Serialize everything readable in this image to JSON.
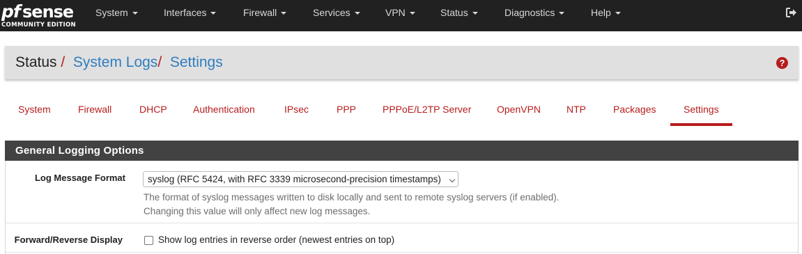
{
  "brand": {
    "logo_pf": "pf",
    "logo_sense": "sense",
    "logo_edition": "COMMUNITY EDITION"
  },
  "nav": {
    "items": [
      "System",
      "Interfaces",
      "Firewall",
      "Services",
      "VPN",
      "Status",
      "Diagnostics",
      "Help"
    ],
    "logout_icon": "sign-out-icon"
  },
  "breadcrumb": {
    "root": "Status",
    "separator": "/",
    "level2": "System Logs",
    "level3": "Settings",
    "help_icon": "question-circle-icon",
    "help_glyph": "?"
  },
  "tabs": {
    "items": [
      "System",
      "Firewall",
      "DHCP",
      "Authentication",
      "IPsec",
      "PPP",
      "PPPoE/L2TP Server",
      "OpenVPN",
      "NTP",
      "Packages",
      "Settings"
    ],
    "active": "Settings"
  },
  "panel": {
    "title": "General Logging Options",
    "log_format": {
      "label": "Log Message Format",
      "selected": "syslog (RFC 5424, with RFC 3339 microsecond-precision timestamps)",
      "help_line1": "The format of syslog messages written to disk locally and sent to remote syslog servers (if enabled).",
      "help_line2": "Changing this value will only affect new log messages."
    },
    "reverse_display": {
      "label": "Forward/Reverse Display",
      "checkbox_label": "Show log entries in reverse order (newest entries on top)",
      "checked": false
    }
  },
  "colors": {
    "navbar_bg": "#212121",
    "accent_red": "#b71c1c",
    "link_blue": "#2f7dbf",
    "panel_head_bg": "#424242",
    "breadcrumb_bg": "#e0e0e0"
  }
}
